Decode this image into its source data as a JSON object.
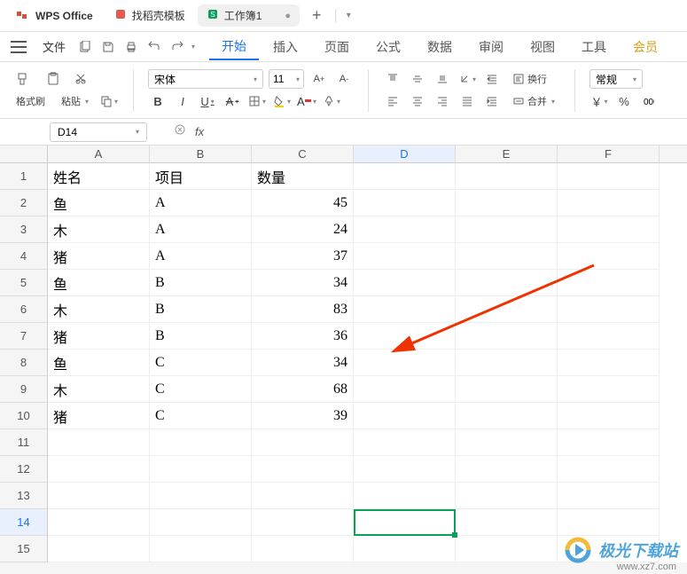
{
  "title_bar": {
    "app_name": "WPS Office",
    "template_tab": "找稻壳模板",
    "sheet_tab": "工作簿1"
  },
  "menu_bar": {
    "file": "文件",
    "tabs": [
      "开始",
      "插入",
      "页面",
      "公式",
      "数据",
      "审阅",
      "视图",
      "工具",
      "会员"
    ],
    "active_tab": 0
  },
  "ribbon": {
    "format_brush": "格式刷",
    "paste": "粘贴",
    "font_name": "宋体",
    "font_size": "11",
    "wrap_text": "换行",
    "merge": "合并",
    "number_format": "常规",
    "currency": "￥",
    "percent": "%"
  },
  "formula_bar": {
    "cell_ref": "D14",
    "formula_value": ""
  },
  "sheet": {
    "columns": [
      "A",
      "B",
      "C",
      "D",
      "E",
      "F"
    ],
    "active_col": 3,
    "row_count": 15,
    "active_row": 14,
    "headers": [
      "姓名",
      "项目",
      "数量"
    ],
    "rows": [
      {
        "name": "鱼",
        "project": "A",
        "qty": 45
      },
      {
        "name": "木",
        "project": "A",
        "qty": 24
      },
      {
        "name": "猪",
        "project": "A",
        "qty": 37
      },
      {
        "name": "鱼",
        "project": "B",
        "qty": 34
      },
      {
        "name": "木",
        "project": "B",
        "qty": 83
      },
      {
        "name": "猪",
        "project": "B",
        "qty": 36
      },
      {
        "name": "鱼",
        "project": "C",
        "qty": 34
      },
      {
        "name": "木",
        "project": "C",
        "qty": 68
      },
      {
        "name": "猪",
        "project": "C",
        "qty": 39
      }
    ]
  },
  "watermark": {
    "text": "极光下载站",
    "url": "www.xz7.com"
  }
}
